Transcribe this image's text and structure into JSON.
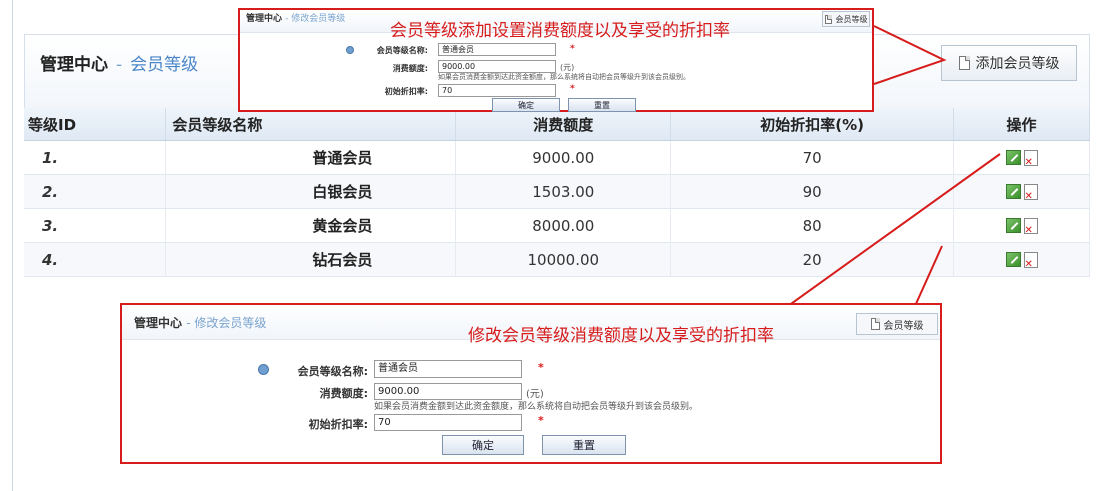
{
  "header": {
    "title": "管理中心",
    "separator": "-",
    "subtitle": "会员等级",
    "add_button_label": "添加会员等级"
  },
  "table": {
    "columns": [
      "等级ID",
      "会员等级名称",
      "消费额度",
      "初始折扣率(%)",
      "操作"
    ],
    "rows": [
      {
        "id": "1.",
        "name": "普通会员",
        "amount": "9000.00",
        "discount": "70"
      },
      {
        "id": "2.",
        "name": "白银会员",
        "amount": "1503.00",
        "discount": "90"
      },
      {
        "id": "3.",
        "name": "黄金会员",
        "amount": "8000.00",
        "discount": "80"
      },
      {
        "id": "4.",
        "name": "钻石会员",
        "amount": "10000.00",
        "discount": "20"
      }
    ]
  },
  "callout_add": {
    "caption": "会员等级添加设置消费额度以及享受的折扣率",
    "title": "管理中心",
    "subtitle": "- 修改会员等级",
    "top_button": "会员等级",
    "form": {
      "name_label": "会员等级名称:",
      "name_value": "普通会员",
      "amount_label": "消费额度:",
      "amount_value": "9000.00",
      "unit": "(元)",
      "hint": "如果会员消费金额到达此资金额度，那么系统将自动把会员等级升到该会员级别。",
      "discount_label": "初始折扣率:",
      "discount_value": "70",
      "required_mark": "*",
      "confirm": "确定",
      "reset": "重置"
    }
  },
  "callout_edit": {
    "caption": "修改会员等级消费额度以及享受的折扣率",
    "title": "管理中心",
    "subtitle": "- 修改会员等级",
    "top_button": "会员等级",
    "form": {
      "name_label": "会员等级名称:",
      "name_value": "普通会员",
      "amount_label": "消费额度:",
      "amount_value": "9000.00",
      "unit": "(元)",
      "hint": "如果会员消费金额到达此资金额度，那么系统将自动把会员等级升到该会员级别。",
      "discount_label": "初始折扣率:",
      "discount_value": "70",
      "required_mark": "*",
      "confirm": "确定",
      "reset": "重置"
    }
  },
  "colors": {
    "accent": "#4a86c8",
    "callout_red": "#d71c1c",
    "header_bg": "#e4edf7"
  }
}
